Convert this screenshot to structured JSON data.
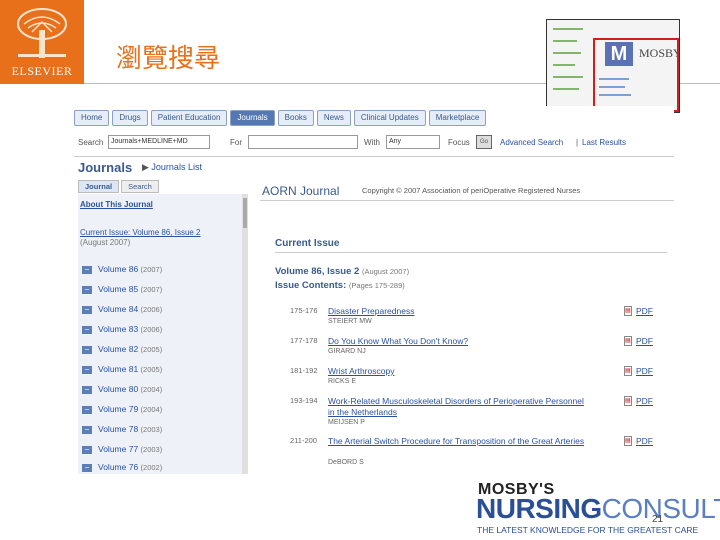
{
  "slide": {
    "logo_text": "ELSEVIER",
    "title": "瀏覽搜尋",
    "page_number": "21"
  },
  "thumbnail": {
    "brand": "MOSBY"
  },
  "app": {
    "tabs": [
      {
        "label": "Home",
        "active": false
      },
      {
        "label": "Drugs",
        "active": false
      },
      {
        "label": "Patient Education",
        "active": false
      },
      {
        "label": "Journals",
        "active": true
      },
      {
        "label": "Books",
        "active": false
      },
      {
        "label": "News",
        "active": false
      },
      {
        "label": "Clinical Updates",
        "active": false
      },
      {
        "label": "Marketplace",
        "active": false
      }
    ],
    "search": {
      "search_label": "Search",
      "scope_value": "Journals+MEDLINE+MD",
      "for_label": "For",
      "with_label": "With",
      "with_value": "Any",
      "focus_label": "Focus",
      "go_label": "Go",
      "advanced_label": "Advanced Search",
      "separator": "|",
      "last_results_label": "Last Results"
    },
    "page_title": "Journals",
    "journals_list_link": "Journals List",
    "left_panel": {
      "tabs": [
        {
          "label": "Journal",
          "active": true
        },
        {
          "label": "Search",
          "active": false
        }
      ],
      "about_link": "About This Journal",
      "current_issue_link": "Current Issue: Volume 86, Issue 2",
      "current_issue_date": "(August 2007)",
      "volumes": [
        {
          "label": "Volume 86",
          "year": "(2007)"
        },
        {
          "label": "Volume 85",
          "year": "(2007)"
        },
        {
          "label": "Volume 84",
          "year": "(2006)"
        },
        {
          "label": "Volume 83",
          "year": "(2006)"
        },
        {
          "label": "Volume 82",
          "year": "(2005)"
        },
        {
          "label": "Volume 81",
          "year": "(2005)"
        },
        {
          "label": "Volume 80",
          "year": "(2004)"
        },
        {
          "label": "Volume 79",
          "year": "(2004)"
        },
        {
          "label": "Volume 78",
          "year": "(2003)"
        },
        {
          "label": "Volume 77",
          "year": "(2003)"
        },
        {
          "label": "Volume 76",
          "year": "(2002)"
        }
      ]
    },
    "right_panel": {
      "journal_name": "AORN Journal",
      "copyright": "Copyright © 2007 Association of periOperative Registered Nurses",
      "current_issue_heading": "Current Issue",
      "volume_heading": "Volume 86, Issue 2",
      "volume_date": "(August 2007)",
      "issue_contents_label": "Issue Contents:",
      "issue_pages": "(Pages 175-289)",
      "pdf_label": "PDF",
      "articles": [
        {
          "pages": "175-176",
          "title": "Disaster Preparedness",
          "author": "STEIERT MW"
        },
        {
          "pages": "177-178",
          "title": "Do You Know What You Don't Know?",
          "author": "GIRARD NJ"
        },
        {
          "pages": "181-192",
          "title": "Wrist Arthroscopy",
          "author": "RICKS E"
        },
        {
          "pages": "193-194",
          "title": "Work-Related Musculoskeletal Disorders of Perioperative Personnel in the Netherlands",
          "author": "MEIJSEN P"
        },
        {
          "pages": "211-200",
          "title": "The Arterial Switch Procedure for Transposition of the Great Arteries",
          "author": "DeBORD S"
        }
      ]
    }
  },
  "branding": {
    "line1": "MOSBY'S",
    "line2a": "NURSING",
    "line2b": "CONSULT",
    "tagline": "THE LATEST KNOWLEDGE FOR THE GREATEST CARE"
  },
  "colors": {
    "accent": "#e8701a",
    "link": "#2a52a0",
    "brand_blue": "#2a4f96",
    "red_box": "#d21d1d"
  }
}
